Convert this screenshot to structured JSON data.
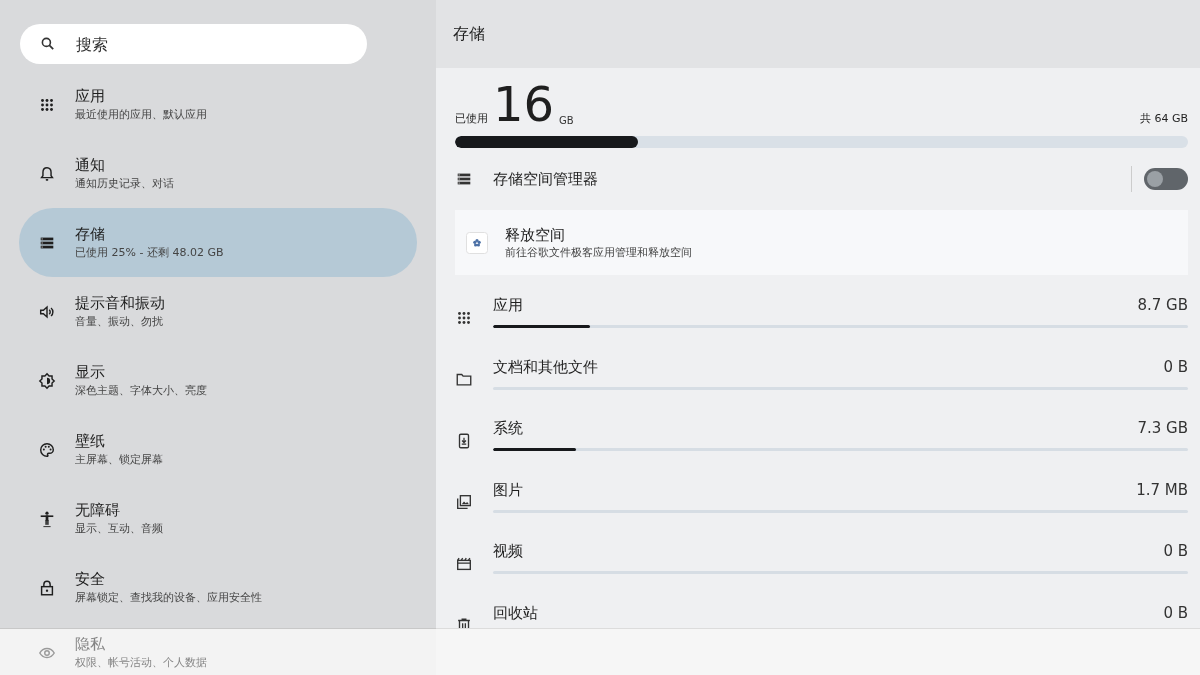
{
  "search": {
    "placeholder": "搜索"
  },
  "sidebar": {
    "items": [
      {
        "kind": "apps",
        "title": "应用",
        "subtitle": "最近使用的应用、默认应用",
        "selected": false,
        "faded": false
      },
      {
        "kind": "notifications",
        "title": "通知",
        "subtitle": "通知历史记录、对话",
        "selected": false,
        "faded": false
      },
      {
        "kind": "storage",
        "title": "存储",
        "subtitle": "已使用 25% - 还剩 48.02 GB",
        "selected": true,
        "faded": false
      },
      {
        "kind": "sound",
        "title": "提示音和振动",
        "subtitle": "音量、振动、勿扰",
        "selected": false,
        "faded": false
      },
      {
        "kind": "display",
        "title": "显示",
        "subtitle": "深色主题、字体大小、亮度",
        "selected": false,
        "faded": false
      },
      {
        "kind": "wallpaper",
        "title": "壁纸",
        "subtitle": "主屏幕、锁定屏幕",
        "selected": false,
        "faded": false
      },
      {
        "kind": "accessibility",
        "title": "无障碍",
        "subtitle": "显示、互动、音频",
        "selected": false,
        "faded": false
      },
      {
        "kind": "security",
        "title": "安全",
        "subtitle": "屏幕锁定、查找我的设备、应用安全性",
        "selected": false,
        "faded": false
      },
      {
        "kind": "privacy",
        "title": "隐私",
        "subtitle": "权限、帐号活动、个人数据",
        "selected": false,
        "faded": true
      }
    ]
  },
  "page": {
    "title": "存储",
    "usage": {
      "label": "已使用",
      "amount": "16",
      "unit": "GB",
      "total": "共 64 GB",
      "level": 0.25
    },
    "manager": {
      "label": "存储空间管理器",
      "on": false
    },
    "free_space": {
      "title": "释放空间",
      "subtitle": "前往谷歌文件极客应用管理和释放空间"
    },
    "categories": [
      {
        "kind": "apps",
        "label": "应用",
        "size": "8.7 GB",
        "level": 0.14
      },
      {
        "kind": "folder",
        "label": "文档和其他文件",
        "size": "0 B"
      },
      {
        "kind": "system",
        "label": "系统",
        "size": "7.3 GB",
        "level": 0.12
      },
      {
        "kind": "images",
        "label": "图片",
        "size": "1.7 MB"
      },
      {
        "kind": "video",
        "label": "视频",
        "size": "0 B"
      },
      {
        "kind": "trash",
        "label": "回收站",
        "size": "0 B"
      }
    ]
  }
}
